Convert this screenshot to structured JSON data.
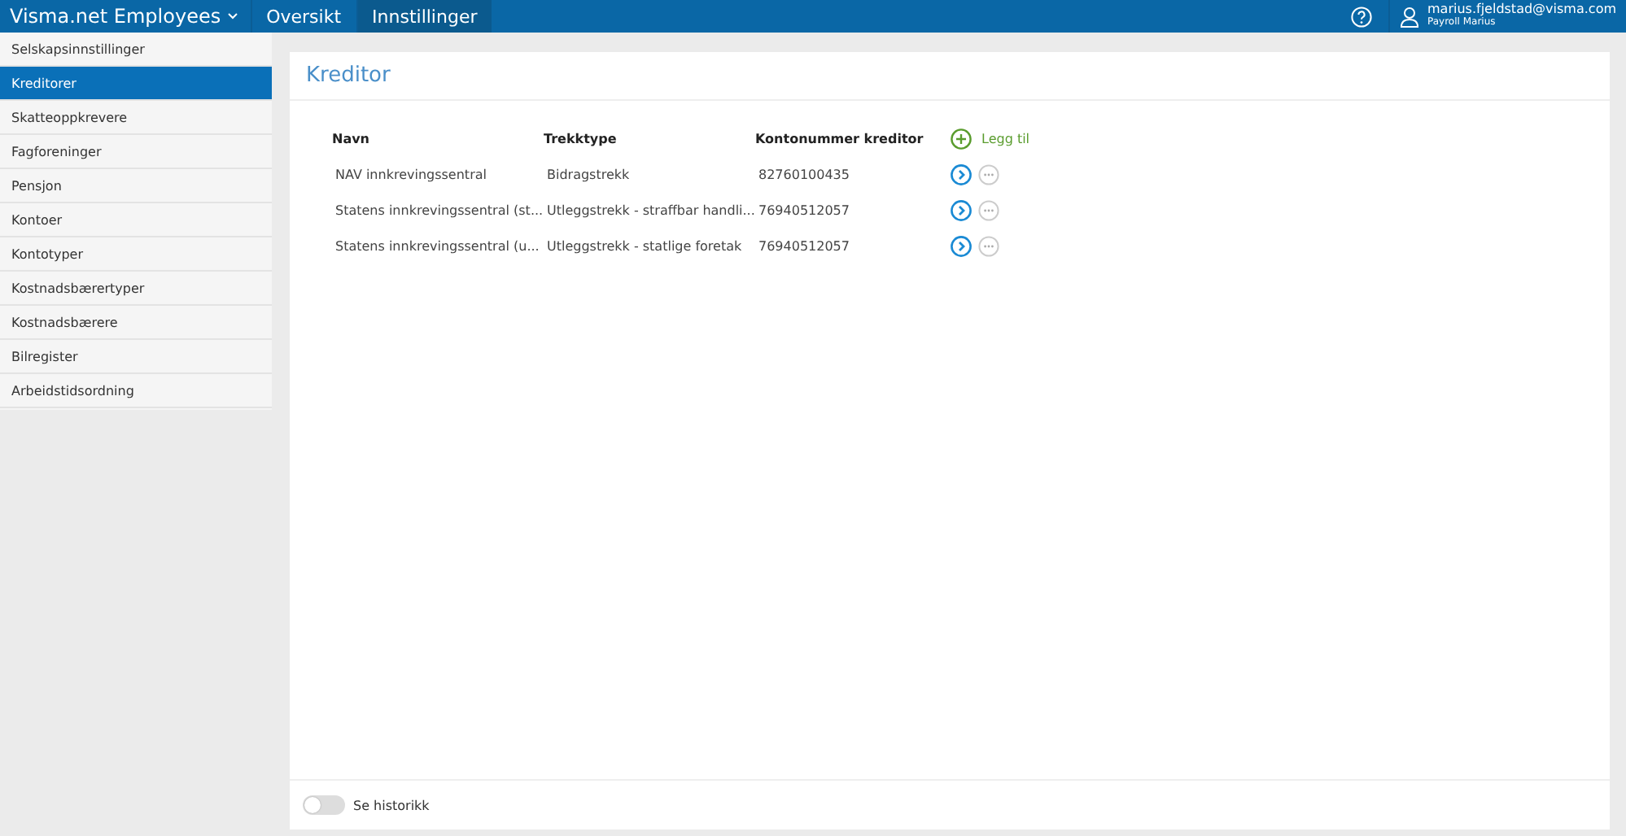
{
  "topbar": {
    "app_name": "Visma.net Employees",
    "tabs": [
      {
        "label": "Oversikt",
        "selected": false
      },
      {
        "label": "Innstillinger",
        "selected": true
      }
    ],
    "user": {
      "email": "marius.fjeldstad@visma.com",
      "name": "Payroll Marius"
    }
  },
  "sidebar": {
    "items": [
      {
        "label": "Selskapsinnstillinger",
        "selected": false
      },
      {
        "label": "Kreditorer",
        "selected": true
      },
      {
        "label": "Skatteoppkrevere",
        "selected": false
      },
      {
        "label": "Fagforeninger",
        "selected": false
      },
      {
        "label": "Pensjon",
        "selected": false
      },
      {
        "label": "Kontoer",
        "selected": false
      },
      {
        "label": "Kontotyper",
        "selected": false
      },
      {
        "label": "Kostnadsbærertyper",
        "selected": false
      },
      {
        "label": "Kostnadsbærere",
        "selected": false
      },
      {
        "label": "Bilregister",
        "selected": false
      },
      {
        "label": "Arbeidstidsordning",
        "selected": false
      }
    ]
  },
  "panel": {
    "title": "Kreditor",
    "add_label": "Legg til",
    "table": {
      "columns": [
        "Navn",
        "Trekktype",
        "Kontonummer kreditor"
      ],
      "rows": [
        [
          "NAV innkrevingssentral",
          "Bidragstrekk",
          "82760100435"
        ],
        [
          "Statens innkrevingssentral (st...",
          "Utleggstrekk - straffbar handli...",
          "76940512057"
        ],
        [
          "Statens innkrevingssentral (u...",
          "Utleggstrekk - statlige foretak",
          "76940512057"
        ]
      ]
    },
    "history_toggle": {
      "label": "Se historikk",
      "on": false
    }
  }
}
